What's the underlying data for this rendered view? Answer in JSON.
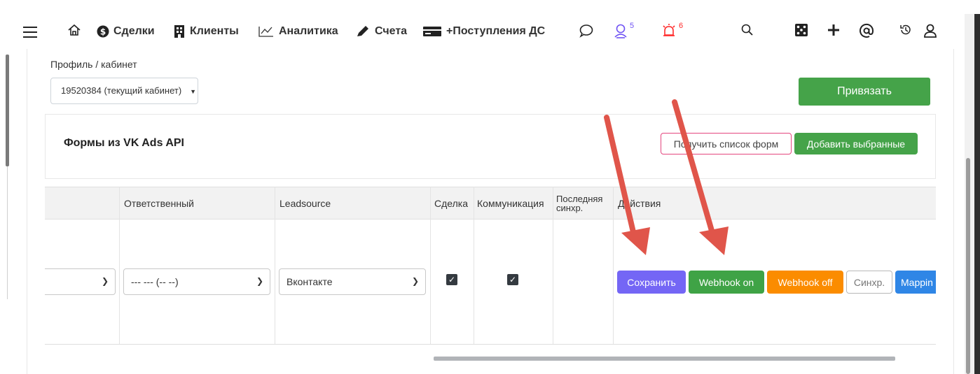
{
  "nav": {
    "items": [
      {
        "icon": "dollar-circle-icon",
        "label": "Сделки"
      },
      {
        "icon": "building-icon",
        "label": "Клиенты"
      },
      {
        "icon": "chart-icon",
        "label": "Аналитика"
      },
      {
        "icon": "pencil-icon",
        "label": "Счета"
      },
      {
        "icon": "card-icon",
        "label": "+Поступления ДС"
      }
    ],
    "contacts_badge": "5",
    "alerts_badge": "6"
  },
  "profile": {
    "label": "Профиль / кабинет",
    "selected": "19520384 (текущий кабинет)",
    "bind_button": "Привязать"
  },
  "forms": {
    "title": "Формы из VK Ads API",
    "get_list_button": "Получить список форм",
    "add_selected_button": "Добавить выбранные"
  },
  "table": {
    "headers": {
      "responsible": "Ответственный",
      "leadsource": "Leadsource",
      "deal": "Сделка",
      "communication": "Коммуникация",
      "last_sync": "Последняя синхр.",
      "actions": "Действия"
    },
    "row": {
      "responsible": "--- --- (-- --)",
      "leadsource": "Вконтакте",
      "deal_checked": true,
      "communication_checked": true,
      "actions": {
        "save": "Сохранить",
        "webhook_on": "Webhook on",
        "webhook_off": "Webhook off",
        "sync": "Синхр.",
        "mapping": "Mappin"
      }
    }
  },
  "colors": {
    "green": "#45a349",
    "purple": "#7466f5",
    "orange": "#fb8c00",
    "blue": "#2f86e6",
    "pink": "#e4467e",
    "arrow": "#e0554a"
  }
}
